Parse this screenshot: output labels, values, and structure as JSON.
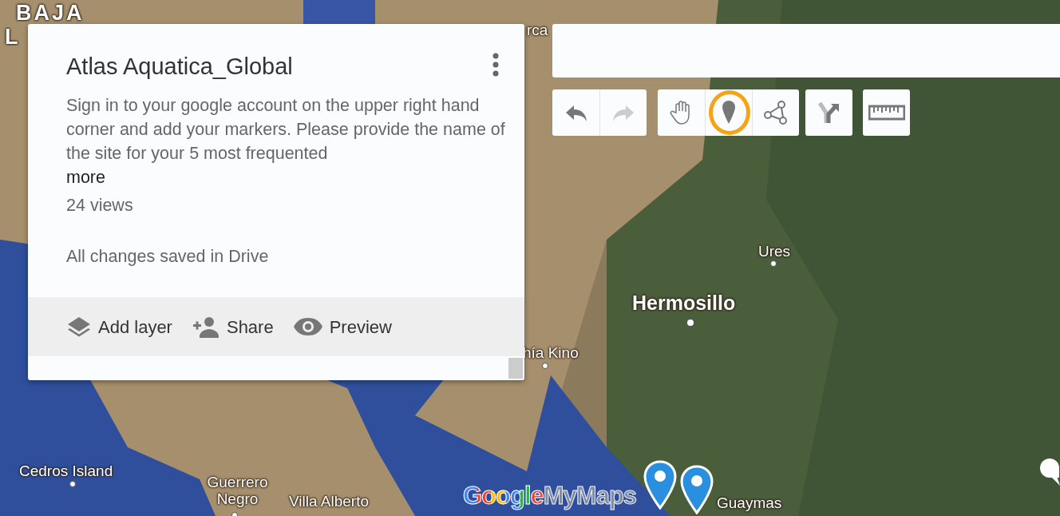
{
  "map": {
    "labels": [
      {
        "text": "BAJA",
        "kind": "region"
      },
      {
        "text": "L",
        "kind": "region"
      },
      {
        "text": "rca",
        "kind": "town"
      },
      {
        "text": "Ures",
        "kind": "town"
      },
      {
        "text": "Hermosillo",
        "kind": "city"
      },
      {
        "text": "hía Kino",
        "kind": "town"
      },
      {
        "text": "Cedros Island",
        "kind": "town"
      },
      {
        "text": "Guerrero Negro",
        "kind": "town"
      },
      {
        "text": "Villa Alberto",
        "kind": "town"
      },
      {
        "text": "Guaymas",
        "kind": "town"
      }
    ],
    "markers": [
      {
        "kind": "pin"
      },
      {
        "kind": "pin"
      }
    ],
    "logo": {
      "brand": "Google",
      "product": "MyMaps"
    }
  },
  "panel": {
    "title": "Atlas Aquatica_Global",
    "description": "Sign in to your google account on the upper right hand corner and add your markers. Please provide the name of the site for your 5 most frequented",
    "more_link": "more",
    "views": "24 views",
    "save_status": "All changes saved in Drive",
    "actions": [
      {
        "label": "Add layer",
        "kind": "layers"
      },
      {
        "label": "Share",
        "kind": "share"
      },
      {
        "label": "Preview",
        "kind": "preview"
      }
    ]
  },
  "toolbar": {
    "groups": [
      [
        {
          "kind": "undo",
          "disabled": false,
          "highlighted": false
        },
        {
          "kind": "redo",
          "disabled": true,
          "highlighted": false
        }
      ],
      [
        {
          "kind": "hand",
          "disabled": false,
          "highlighted": false
        },
        {
          "kind": "marker",
          "disabled": false,
          "highlighted": true
        },
        {
          "kind": "line",
          "disabled": false,
          "highlighted": false
        }
      ],
      [
        {
          "kind": "route",
          "disabled": false,
          "highlighted": false
        }
      ],
      [
        {
          "kind": "ruler",
          "disabled": false,
          "highlighted": false
        }
      ]
    ]
  }
}
